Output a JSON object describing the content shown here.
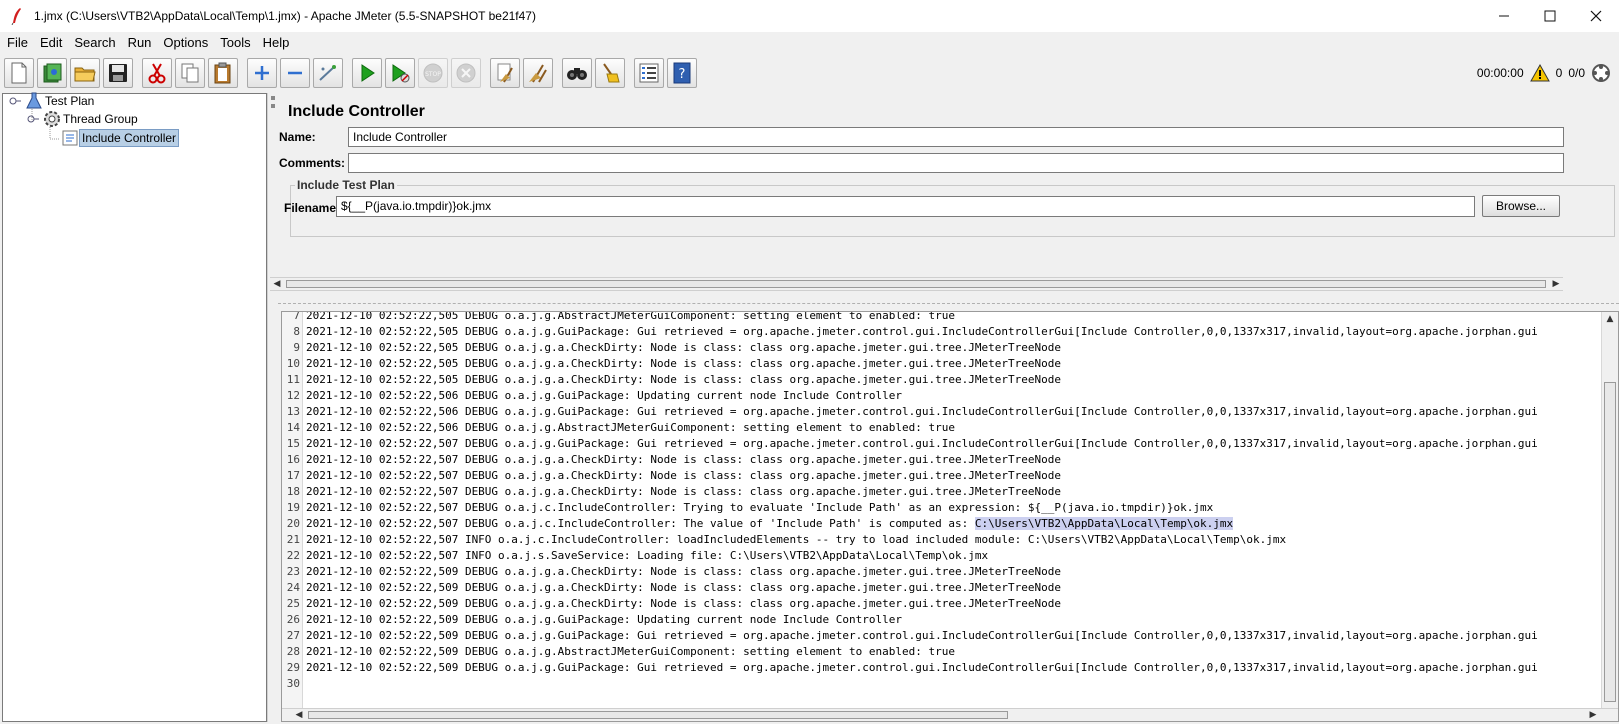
{
  "window": {
    "title": "1.jmx (C:\\Users\\VTB2\\AppData\\Local\\Temp\\1.jmx) - Apache JMeter (5.5-SNAPSHOT be21f47)"
  },
  "menu": [
    "File",
    "Edit",
    "Search",
    "Run",
    "Options",
    "Tools",
    "Help"
  ],
  "status": {
    "timer": "00:00:00",
    "warnings": "0",
    "threads": "0/0"
  },
  "tree": [
    {
      "label": "Test Plan"
    },
    {
      "label": "Thread Group"
    },
    {
      "label": "Include Controller"
    }
  ],
  "panel": {
    "title": "Include Controller",
    "name_label": "Name:",
    "name_value": "Include Controller",
    "comments_label": "Comments:",
    "comments_value": "",
    "group_title": "Include Test Plan",
    "filename_label": "Filename",
    "filename_value": "${__P(java.io.tmpdir)}ok.jmx",
    "browse_label": "Browse..."
  },
  "log": {
    "lines": [
      {
        "n": "7",
        "t": "2021-12-10 02:52:22,505 DEBUG o.a.j.g.AbstractJMeterGuiComponent: setting element to enabled: true"
      },
      {
        "n": "8",
        "t": "2021-12-10 02:52:22,505 DEBUG o.a.j.g.GuiPackage: Gui retrieved = org.apache.jmeter.control.gui.IncludeControllerGui[Include Controller,0,0,1337x317,invalid,layout=org.apache.jorphan.gui"
      },
      {
        "n": "9",
        "t": "2021-12-10 02:52:22,505 DEBUG o.a.j.g.a.CheckDirty: Node is class: class org.apache.jmeter.gui.tree.JMeterTreeNode"
      },
      {
        "n": "10",
        "t": "2021-12-10 02:52:22,505 DEBUG o.a.j.g.a.CheckDirty: Node is class: class org.apache.jmeter.gui.tree.JMeterTreeNode"
      },
      {
        "n": "11",
        "t": "2021-12-10 02:52:22,505 DEBUG o.a.j.g.a.CheckDirty: Node is class: class org.apache.jmeter.gui.tree.JMeterTreeNode"
      },
      {
        "n": "12",
        "t": "2021-12-10 02:52:22,506 DEBUG o.a.j.g.GuiPackage: Updating current node Include Controller"
      },
      {
        "n": "13",
        "t": "2021-12-10 02:52:22,506 DEBUG o.a.j.g.GuiPackage: Gui retrieved = org.apache.jmeter.control.gui.IncludeControllerGui[Include Controller,0,0,1337x317,invalid,layout=org.apache.jorphan.gui"
      },
      {
        "n": "14",
        "t": "2021-12-10 02:52:22,506 DEBUG o.a.j.g.AbstractJMeterGuiComponent: setting element to enabled: true"
      },
      {
        "n": "15",
        "t": "2021-12-10 02:52:22,507 DEBUG o.a.j.g.GuiPackage: Gui retrieved = org.apache.jmeter.control.gui.IncludeControllerGui[Include Controller,0,0,1337x317,invalid,layout=org.apache.jorphan.gui"
      },
      {
        "n": "16",
        "t": "2021-12-10 02:52:22,507 DEBUG o.a.j.g.a.CheckDirty: Node is class: class org.apache.jmeter.gui.tree.JMeterTreeNode"
      },
      {
        "n": "17",
        "t": "2021-12-10 02:52:22,507 DEBUG o.a.j.g.a.CheckDirty: Node is class: class org.apache.jmeter.gui.tree.JMeterTreeNode"
      },
      {
        "n": "18",
        "t": "2021-12-10 02:52:22,507 DEBUG o.a.j.g.a.CheckDirty: Node is class: class org.apache.jmeter.gui.tree.JMeterTreeNode"
      },
      {
        "n": "19",
        "t": "2021-12-10 02:52:22,507 DEBUG o.a.j.c.IncludeController: Trying to evaluate 'Include Path' as an expression: ${__P(java.io.tmpdir)}ok.jmx"
      },
      {
        "n": "20",
        "t": "2021-12-10 02:52:22,507 DEBUG o.a.j.c.IncludeController: The value of 'Include Path' is computed as: ",
        "hl": "C:\\Users\\VTB2\\AppData\\Local\\Temp\\ok.jmx"
      },
      {
        "n": "21",
        "t": "2021-12-10 02:52:22,507 INFO o.a.j.c.IncludeController: loadIncludedElements -- try to load included module: C:\\Users\\VTB2\\AppData\\Local\\Temp\\ok.jmx"
      },
      {
        "n": "22",
        "t": "2021-12-10 02:52:22,507 INFO o.a.j.s.SaveService: Loading file: C:\\Users\\VTB2\\AppData\\Local\\Temp\\ok.jmx"
      },
      {
        "n": "23",
        "t": "2021-12-10 02:52:22,509 DEBUG o.a.j.g.a.CheckDirty: Node is class: class org.apache.jmeter.gui.tree.JMeterTreeNode"
      },
      {
        "n": "24",
        "t": "2021-12-10 02:52:22,509 DEBUG o.a.j.g.a.CheckDirty: Node is class: class org.apache.jmeter.gui.tree.JMeterTreeNode"
      },
      {
        "n": "25",
        "t": "2021-12-10 02:52:22,509 DEBUG o.a.j.g.a.CheckDirty: Node is class: class org.apache.jmeter.gui.tree.JMeterTreeNode"
      },
      {
        "n": "26",
        "t": "2021-12-10 02:52:22,509 DEBUG o.a.j.g.GuiPackage: Updating current node Include Controller"
      },
      {
        "n": "27",
        "t": "2021-12-10 02:52:22,509 DEBUG o.a.j.g.GuiPackage: Gui retrieved = org.apache.jmeter.control.gui.IncludeControllerGui[Include Controller,0,0,1337x317,invalid,layout=org.apache.jorphan.gui"
      },
      {
        "n": "28",
        "t": "2021-12-10 02:52:22,509 DEBUG o.a.j.g.AbstractJMeterGuiComponent: setting element to enabled: true"
      },
      {
        "n": "29",
        "t": "2021-12-10 02:52:22,509 DEBUG o.a.j.g.GuiPackage: Gui retrieved = org.apache.jmeter.control.gui.IncludeControllerGui[Include Controller,0,0,1337x317,invalid,layout=org.apache.jorphan.gui"
      },
      {
        "n": "30",
        "t": ""
      }
    ]
  }
}
